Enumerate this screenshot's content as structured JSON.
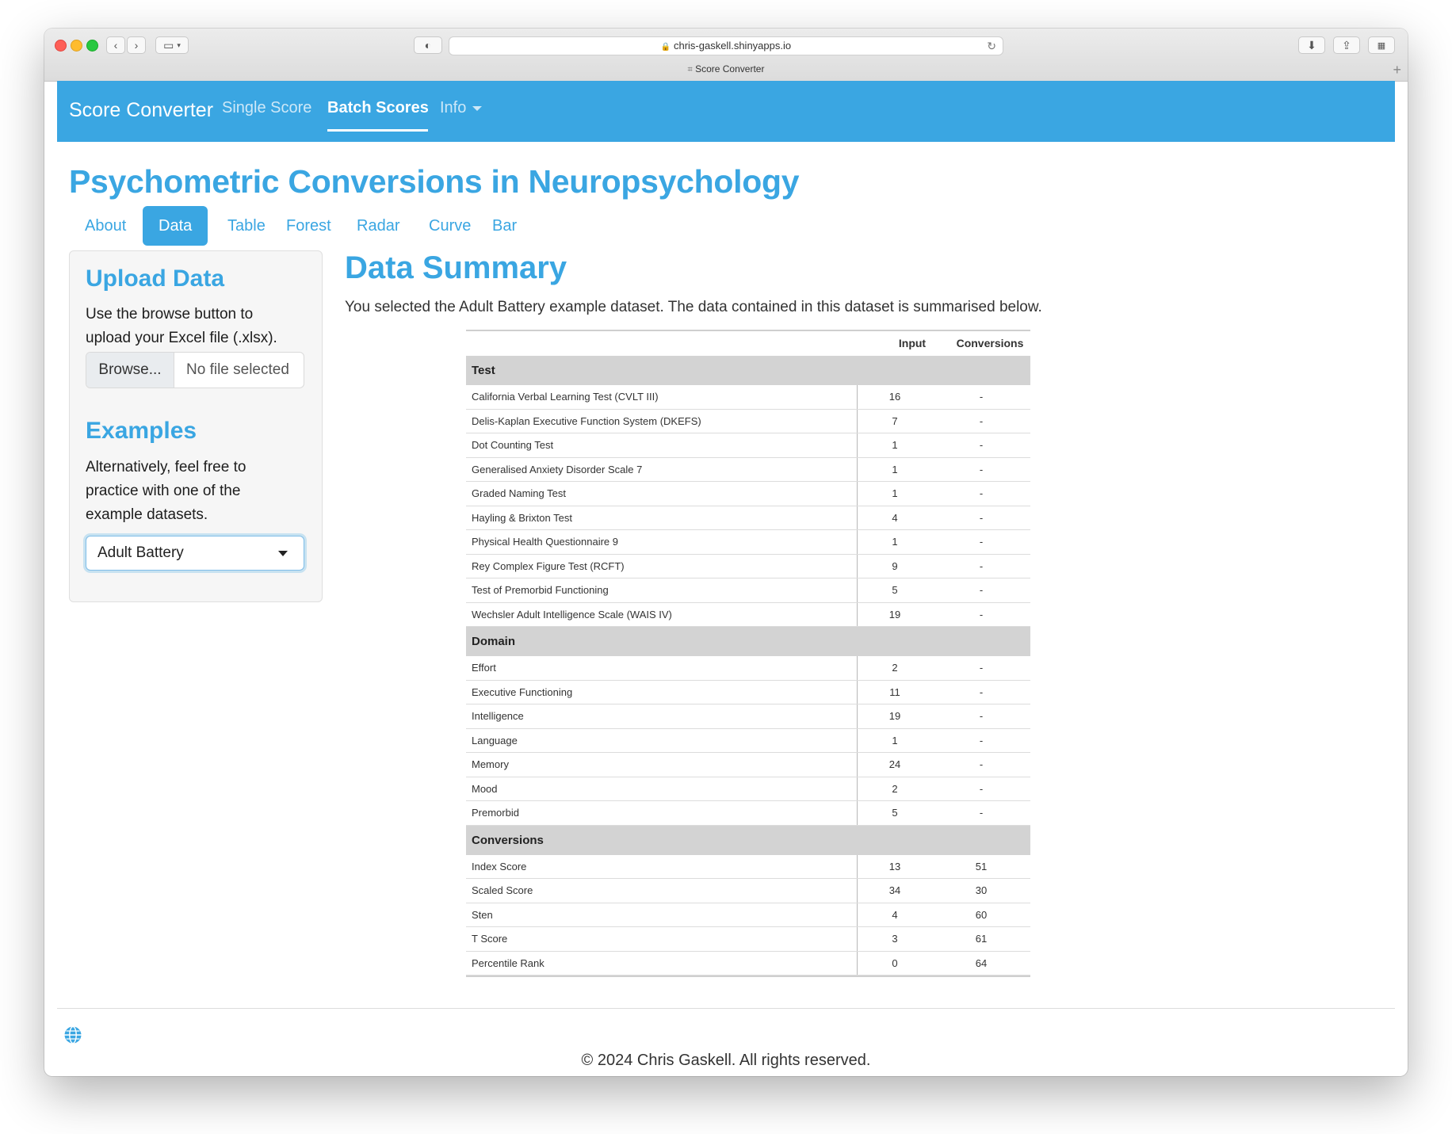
{
  "browser": {
    "url": "chris-gaskell.shinyapps.io",
    "tab_title": "Score Converter"
  },
  "navbar": {
    "brand": "Score Converter",
    "links": [
      "Single Score",
      "Batch Scores",
      "Info"
    ],
    "active": "Batch Scores",
    "bg_color": "#3aa6e2"
  },
  "main": {
    "title": "Psychometric Conversions in Neuropsychology",
    "tabs": [
      "About",
      "Data",
      "Table",
      "Forest",
      "Radar",
      "Curve",
      "Bar"
    ],
    "active_tab": "Data"
  },
  "sidebar": {
    "upload_heading": "Upload Data",
    "upload_text": "Use the browse button to upload your Excel file (.xlsx).",
    "browse_label": "Browse...",
    "file_placeholder": "No file selected",
    "examples_heading": "Examples",
    "examples_text": "Alternatively, feel free to practice with one of the example datasets.",
    "selected_dataset": "Adult Battery"
  },
  "summary": {
    "title": "Data Summary",
    "text": "You selected the Adult Battery example dataset. The data contained in this dataset is summarised below.",
    "columns": [
      "Input",
      "Conversions"
    ],
    "groups": [
      {
        "name": "Test",
        "rows": [
          [
            "California Verbal Learning Test (CVLT III)",
            "16",
            "-"
          ],
          [
            "Delis-Kaplan Executive Function System (DKEFS)",
            "7",
            "-"
          ],
          [
            "Dot Counting Test",
            "1",
            "-"
          ],
          [
            "Generalised Anxiety Disorder Scale 7",
            "1",
            "-"
          ],
          [
            "Graded Naming Test",
            "1",
            "-"
          ],
          [
            "Hayling & Brixton Test",
            "4",
            "-"
          ],
          [
            "Physical Health Questionnaire 9",
            "1",
            "-"
          ],
          [
            "Rey Complex Figure Test (RCFT)",
            "9",
            "-"
          ],
          [
            "Test of Premorbid Functioning",
            "5",
            "-"
          ],
          [
            "Wechsler Adult Intelligence Scale (WAIS IV)",
            "19",
            "-"
          ]
        ]
      },
      {
        "name": "Domain",
        "rows": [
          [
            "Effort",
            "2",
            "-"
          ],
          [
            "Executive Functioning",
            "11",
            "-"
          ],
          [
            "Intelligence",
            "19",
            "-"
          ],
          [
            "Language",
            "1",
            "-"
          ],
          [
            "Memory",
            "24",
            "-"
          ],
          [
            "Mood",
            "2",
            "-"
          ],
          [
            "Premorbid",
            "5",
            "-"
          ]
        ]
      },
      {
        "name": "Conversions",
        "rows": [
          [
            "Index Score",
            "13",
            "51"
          ],
          [
            "Scaled Score",
            "34",
            "30"
          ],
          [
            "Sten",
            "4",
            "60"
          ],
          [
            "T Score",
            "3",
            "61"
          ],
          [
            "Percentile Rank",
            "0",
            "64"
          ]
        ]
      }
    ]
  },
  "footer": {
    "copyright": "© 2024 Chris Gaskell. All rights reserved.",
    "icon": "globe-icon"
  }
}
